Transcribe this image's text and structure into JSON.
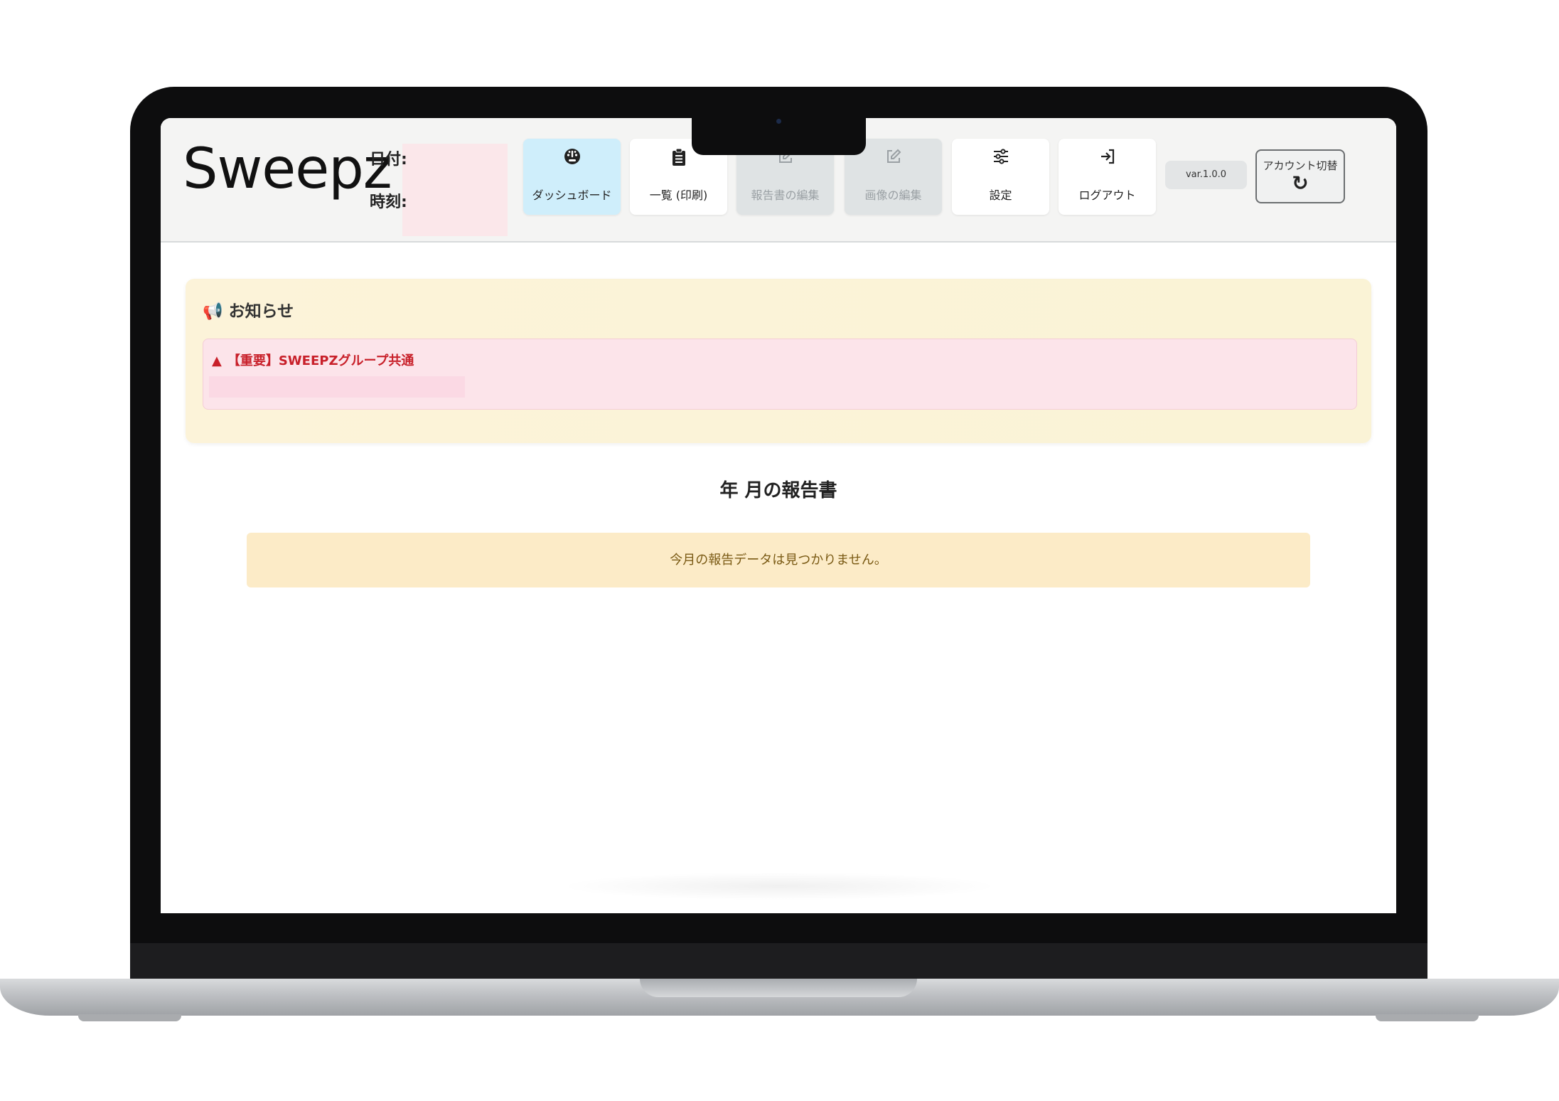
{
  "app": {
    "logo": "Sweepz",
    "date_label": "日付:",
    "time_label": "時刻:",
    "version": "var.1.0.0",
    "account_switch_label": "アカウント切替"
  },
  "nav": [
    {
      "label": "ダッシュボード",
      "icon": "dashboard-icon",
      "state": "active"
    },
    {
      "label": "一覧 (印刷)",
      "icon": "clipboard-icon",
      "state": "normal"
    },
    {
      "label": "報告書の編集",
      "icon": "edit-icon",
      "state": "disabled"
    },
    {
      "label": "画像の編集",
      "icon": "edit-icon",
      "state": "disabled"
    },
    {
      "label": "設定",
      "icon": "sliders-icon",
      "state": "normal"
    },
    {
      "label": "ログアウト",
      "icon": "logout-icon",
      "state": "normal"
    }
  ],
  "notice": {
    "title": "お知らせ",
    "items": [
      {
        "title": "【重要】SWEEPZグループ共通"
      }
    ]
  },
  "report": {
    "title": "年 月の報告書",
    "empty_message": "今月の報告データは見つかりません。"
  },
  "colors": {
    "active_nav": "#cfeefb",
    "notice_bg": "#fcf3d9",
    "alert_text": "#c8202a",
    "empty_bg": "#fcebc7"
  }
}
